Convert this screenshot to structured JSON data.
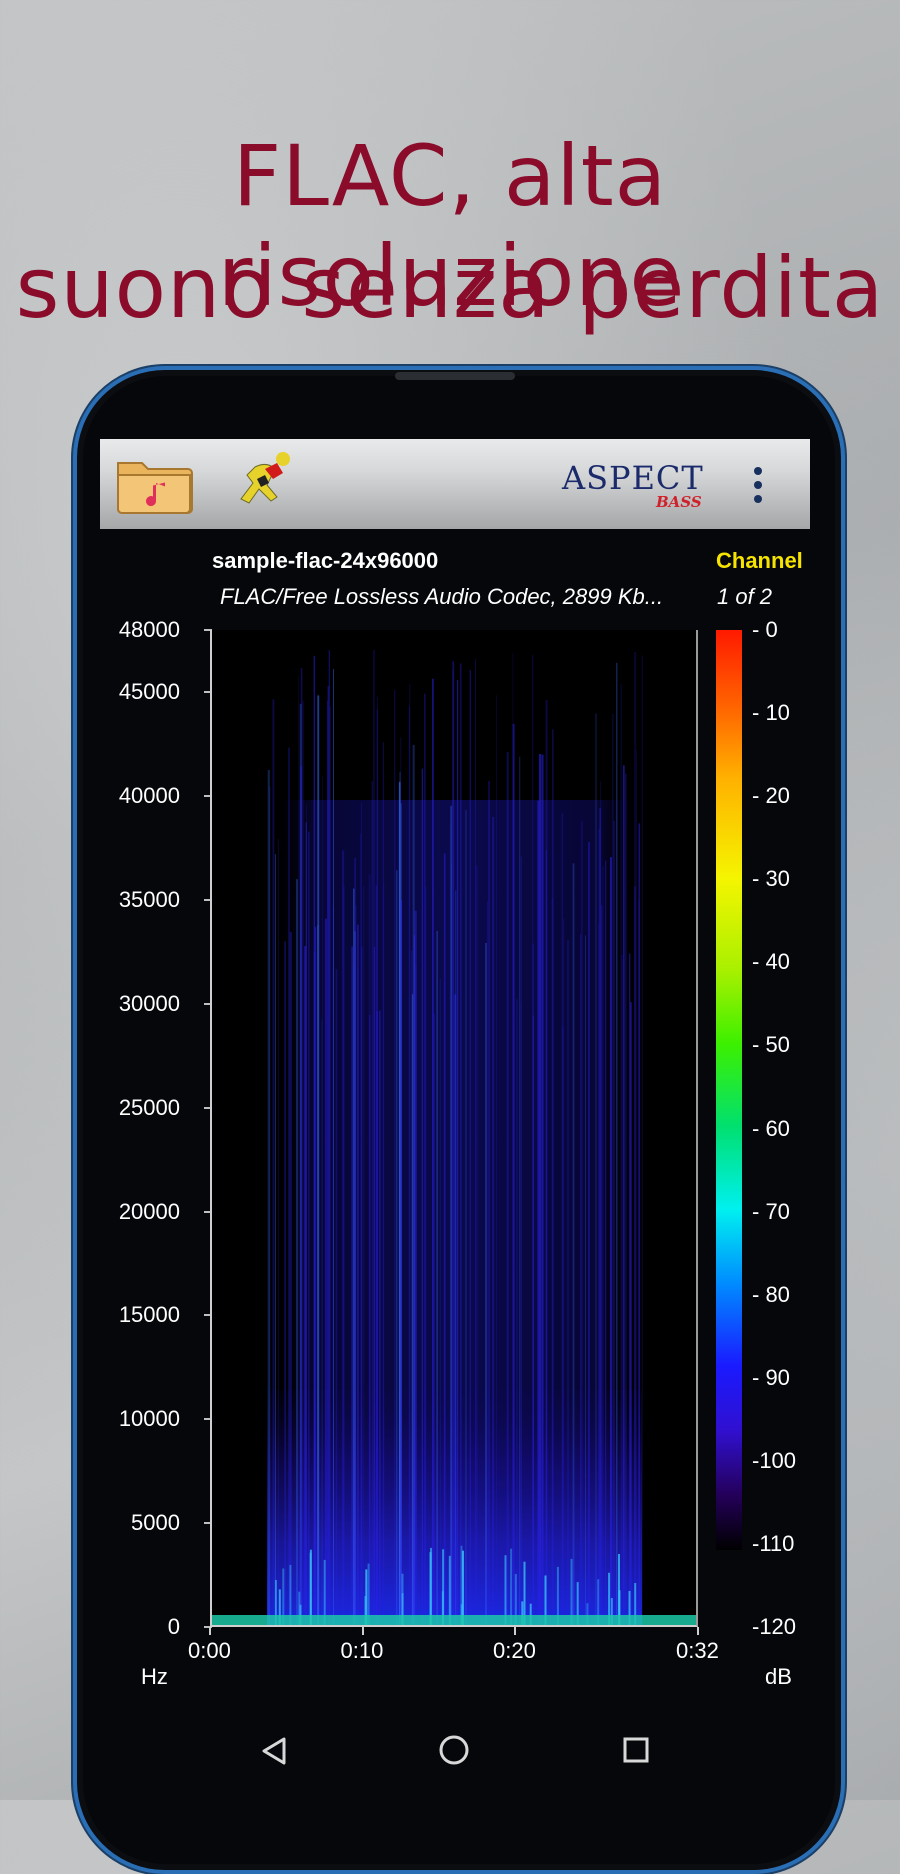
{
  "headline": {
    "line1": "FLAC, alta risoluzione",
    "line2": "suono senza perdita"
  },
  "colors": {
    "headline": "#8a0b2a",
    "channel_label": "#f6e300",
    "phone_frame": "#2a6fb5"
  },
  "toolbar": {
    "folder_icon": "folder-music-icon",
    "runner_icon": "running-figure-icon",
    "logo_main": "ASPECT",
    "logo_sub": "BASS",
    "menu_icon": "more-vertical-icon"
  },
  "file": {
    "title": "sample-flac-24x96000",
    "codec": "FLAC/Free Lossless Audio Codec, 2899 Kb...",
    "channel_label": "Channel",
    "channel_value": "1 of 2"
  },
  "chart_data": {
    "type": "heatmap",
    "ylabel": "Hz",
    "xlabel": "",
    "y_ticks": [
      "48000",
      "45000",
      "40000",
      "35000",
      "30000",
      "25000",
      "20000",
      "15000",
      "10000",
      "5000",
      "0"
    ],
    "y_tick_values": [
      48000,
      45000,
      40000,
      35000,
      30000,
      25000,
      20000,
      15000,
      10000,
      5000,
      0
    ],
    "ylim": [
      0,
      48000
    ],
    "x_ticks": [
      "0:00",
      "0:10",
      "0:20",
      "0:32"
    ],
    "x_tick_values": [
      0,
      10,
      20,
      32
    ],
    "xlim": [
      0,
      32
    ],
    "colorbar": {
      "unit": "dB",
      "labels": [
        "- 0",
        "- 10",
        "- 20",
        "- 30",
        "- 40",
        "- 50",
        "- 60",
        "- 70",
        "- 80",
        "- 90",
        "-100",
        "-110",
        "-120"
      ],
      "range": [
        -120,
        0
      ]
    }
  },
  "navbar": {
    "back_icon": "back-triangle-icon",
    "home_icon": "home-circle-icon",
    "recent_icon": "recent-apps-square-icon"
  }
}
